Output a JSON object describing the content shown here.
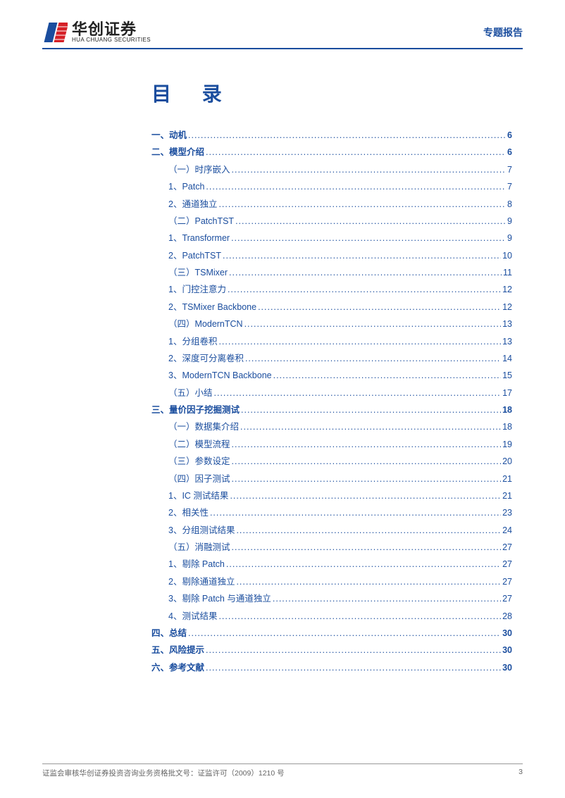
{
  "header": {
    "logo_cn": "华创证券",
    "logo_en": "HUA CHUANG SECURITIES",
    "report_type": "专题报告"
  },
  "toc_title_label": "目 录",
  "toc": [
    {
      "level": 1,
      "label": "一、动机",
      "page": "6"
    },
    {
      "level": 1,
      "label": "二、模型介绍",
      "page": "6"
    },
    {
      "level": 2,
      "label": "（一）时序嵌入",
      "page": "7"
    },
    {
      "level": 3,
      "label": "1、Patch",
      "page": "7"
    },
    {
      "level": 3,
      "label": "2、通道独立",
      "page": "8"
    },
    {
      "level": 2,
      "label": "（二）PatchTST",
      "page": "9"
    },
    {
      "level": 3,
      "label": "1、Transformer",
      "page": "9"
    },
    {
      "level": 3,
      "label": "2、PatchTST",
      "page": "10"
    },
    {
      "level": 2,
      "label": "（三）TSMixer",
      "page": "11"
    },
    {
      "level": 3,
      "label": "1、门控注意力",
      "page": "12"
    },
    {
      "level": 3,
      "label": "2、TSMixer Backbone",
      "page": "12"
    },
    {
      "level": 2,
      "label": "（四）ModernTCN",
      "page": "13"
    },
    {
      "level": 3,
      "label": "1、分组卷积",
      "page": "13"
    },
    {
      "level": 3,
      "label": "2、深度可分离卷积",
      "page": "14"
    },
    {
      "level": 3,
      "label": "3、ModernTCN Backbone",
      "page": "15"
    },
    {
      "level": 2,
      "label": "（五）小结",
      "page": "17"
    },
    {
      "level": 1,
      "label": "三、量价因子挖掘测试",
      "page": "18"
    },
    {
      "level": 2,
      "label": "（一）数据集介绍",
      "page": "18"
    },
    {
      "level": 2,
      "label": "（二）模型流程",
      "page": "19"
    },
    {
      "level": 2,
      "label": "（三）参数设定",
      "page": "20"
    },
    {
      "level": 2,
      "label": "（四）因子测试",
      "page": "21"
    },
    {
      "level": 3,
      "label": "1、IC 测试结果",
      "page": "21"
    },
    {
      "level": 3,
      "label": "2、相关性",
      "page": "23"
    },
    {
      "level": 3,
      "label": "3、分组测试结果",
      "page": "24"
    },
    {
      "level": 2,
      "label": "（五）消融测试",
      "page": "27"
    },
    {
      "level": 3,
      "label": "1、剔除 Patch",
      "page": "27"
    },
    {
      "level": 3,
      "label": "2、剔除通道独立",
      "page": "27"
    },
    {
      "level": 3,
      "label": "3、剔除 Patch 与通道独立",
      "page": "27"
    },
    {
      "level": 3,
      "label": "4、测试结果",
      "page": "28"
    },
    {
      "level": 1,
      "label": "四、总结",
      "page": "30"
    },
    {
      "level": 1,
      "label": "五、风险提示",
      "page": "30"
    },
    {
      "level": 1,
      "label": "六、参考文献",
      "page": "30"
    }
  ],
  "footer": {
    "license": "证监会审核华创证券投资咨询业务资格批文号：证监许可（2009）1210 号",
    "page_number": "3"
  }
}
